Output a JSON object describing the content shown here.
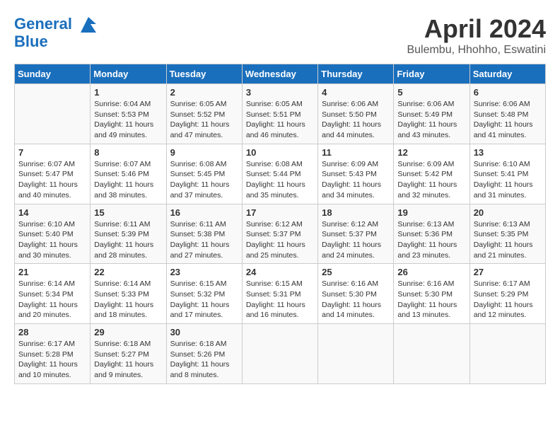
{
  "header": {
    "logo_line1": "General",
    "logo_line2": "Blue",
    "month": "April 2024",
    "location": "Bulembu, Hhohho, Eswatini"
  },
  "days_of_week": [
    "Sunday",
    "Monday",
    "Tuesday",
    "Wednesday",
    "Thursday",
    "Friday",
    "Saturday"
  ],
  "weeks": [
    [
      {
        "day": "",
        "info": ""
      },
      {
        "day": "1",
        "info": "Sunrise: 6:04 AM\nSunset: 5:53 PM\nDaylight: 11 hours\nand 49 minutes."
      },
      {
        "day": "2",
        "info": "Sunrise: 6:05 AM\nSunset: 5:52 PM\nDaylight: 11 hours\nand 47 minutes."
      },
      {
        "day": "3",
        "info": "Sunrise: 6:05 AM\nSunset: 5:51 PM\nDaylight: 11 hours\nand 46 minutes."
      },
      {
        "day": "4",
        "info": "Sunrise: 6:06 AM\nSunset: 5:50 PM\nDaylight: 11 hours\nand 44 minutes."
      },
      {
        "day": "5",
        "info": "Sunrise: 6:06 AM\nSunset: 5:49 PM\nDaylight: 11 hours\nand 43 minutes."
      },
      {
        "day": "6",
        "info": "Sunrise: 6:06 AM\nSunset: 5:48 PM\nDaylight: 11 hours\nand 41 minutes."
      }
    ],
    [
      {
        "day": "7",
        "info": "Sunrise: 6:07 AM\nSunset: 5:47 PM\nDaylight: 11 hours\nand 40 minutes."
      },
      {
        "day": "8",
        "info": "Sunrise: 6:07 AM\nSunset: 5:46 PM\nDaylight: 11 hours\nand 38 minutes."
      },
      {
        "day": "9",
        "info": "Sunrise: 6:08 AM\nSunset: 5:45 PM\nDaylight: 11 hours\nand 37 minutes."
      },
      {
        "day": "10",
        "info": "Sunrise: 6:08 AM\nSunset: 5:44 PM\nDaylight: 11 hours\nand 35 minutes."
      },
      {
        "day": "11",
        "info": "Sunrise: 6:09 AM\nSunset: 5:43 PM\nDaylight: 11 hours\nand 34 minutes."
      },
      {
        "day": "12",
        "info": "Sunrise: 6:09 AM\nSunset: 5:42 PM\nDaylight: 11 hours\nand 32 minutes."
      },
      {
        "day": "13",
        "info": "Sunrise: 6:10 AM\nSunset: 5:41 PM\nDaylight: 11 hours\nand 31 minutes."
      }
    ],
    [
      {
        "day": "14",
        "info": "Sunrise: 6:10 AM\nSunset: 5:40 PM\nDaylight: 11 hours\nand 30 minutes."
      },
      {
        "day": "15",
        "info": "Sunrise: 6:11 AM\nSunset: 5:39 PM\nDaylight: 11 hours\nand 28 minutes."
      },
      {
        "day": "16",
        "info": "Sunrise: 6:11 AM\nSunset: 5:38 PM\nDaylight: 11 hours\nand 27 minutes."
      },
      {
        "day": "17",
        "info": "Sunrise: 6:12 AM\nSunset: 5:37 PM\nDaylight: 11 hours\nand 25 minutes."
      },
      {
        "day": "18",
        "info": "Sunrise: 6:12 AM\nSunset: 5:37 PM\nDaylight: 11 hours\nand 24 minutes."
      },
      {
        "day": "19",
        "info": "Sunrise: 6:13 AM\nSunset: 5:36 PM\nDaylight: 11 hours\nand 23 minutes."
      },
      {
        "day": "20",
        "info": "Sunrise: 6:13 AM\nSunset: 5:35 PM\nDaylight: 11 hours\nand 21 minutes."
      }
    ],
    [
      {
        "day": "21",
        "info": "Sunrise: 6:14 AM\nSunset: 5:34 PM\nDaylight: 11 hours\nand 20 minutes."
      },
      {
        "day": "22",
        "info": "Sunrise: 6:14 AM\nSunset: 5:33 PM\nDaylight: 11 hours\nand 18 minutes."
      },
      {
        "day": "23",
        "info": "Sunrise: 6:15 AM\nSunset: 5:32 PM\nDaylight: 11 hours\nand 17 minutes."
      },
      {
        "day": "24",
        "info": "Sunrise: 6:15 AM\nSunset: 5:31 PM\nDaylight: 11 hours\nand 16 minutes."
      },
      {
        "day": "25",
        "info": "Sunrise: 6:16 AM\nSunset: 5:30 PM\nDaylight: 11 hours\nand 14 minutes."
      },
      {
        "day": "26",
        "info": "Sunrise: 6:16 AM\nSunset: 5:30 PM\nDaylight: 11 hours\nand 13 minutes."
      },
      {
        "day": "27",
        "info": "Sunrise: 6:17 AM\nSunset: 5:29 PM\nDaylight: 11 hours\nand 12 minutes."
      }
    ],
    [
      {
        "day": "28",
        "info": "Sunrise: 6:17 AM\nSunset: 5:28 PM\nDaylight: 11 hours\nand 10 minutes."
      },
      {
        "day": "29",
        "info": "Sunrise: 6:18 AM\nSunset: 5:27 PM\nDaylight: 11 hours\nand 9 minutes."
      },
      {
        "day": "30",
        "info": "Sunrise: 6:18 AM\nSunset: 5:26 PM\nDaylight: 11 hours\nand 8 minutes."
      },
      {
        "day": "",
        "info": ""
      },
      {
        "day": "",
        "info": ""
      },
      {
        "day": "",
        "info": ""
      },
      {
        "day": "",
        "info": ""
      }
    ]
  ]
}
